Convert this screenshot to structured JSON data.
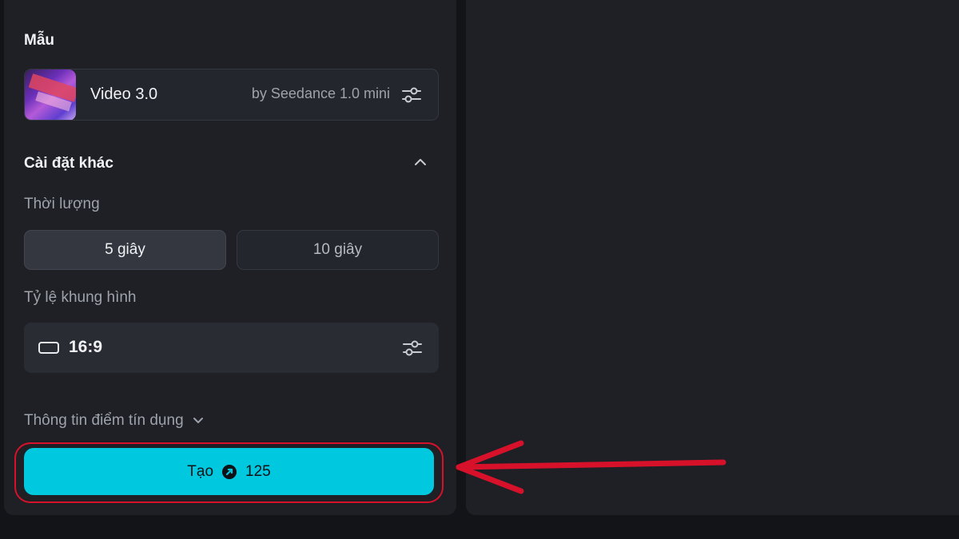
{
  "template_section": {
    "title": "Mẫu",
    "model": {
      "name": "Video 3.0",
      "provider": "by Seedance 1.0 mini",
      "thumbnail_icon": "model-thumbnail",
      "settings_icon": "sliders-icon"
    }
  },
  "other_settings": {
    "title": "Cài đặt khác",
    "collapse_icon": "chevron-up-icon",
    "duration": {
      "label": "Thời lượng",
      "options": [
        "5 giây",
        "10 giây"
      ],
      "selected": "5 giây"
    },
    "aspect_ratio": {
      "label": "Tỷ lệ khung hình",
      "value": "16:9",
      "icon": "landscape-ratio-icon",
      "settings_icon": "sliders-icon"
    }
  },
  "credit_info": {
    "label": "Thông tin điểm tín dụng",
    "icon": "chevron-down-icon"
  },
  "generate": {
    "label": "Tạo",
    "credit_cost": "125",
    "icon": "credit-coin-icon"
  },
  "colors": {
    "accent": "#00c8de",
    "annotation": "#d8112b",
    "panel": "#1e2026",
    "background": "#131417"
  }
}
